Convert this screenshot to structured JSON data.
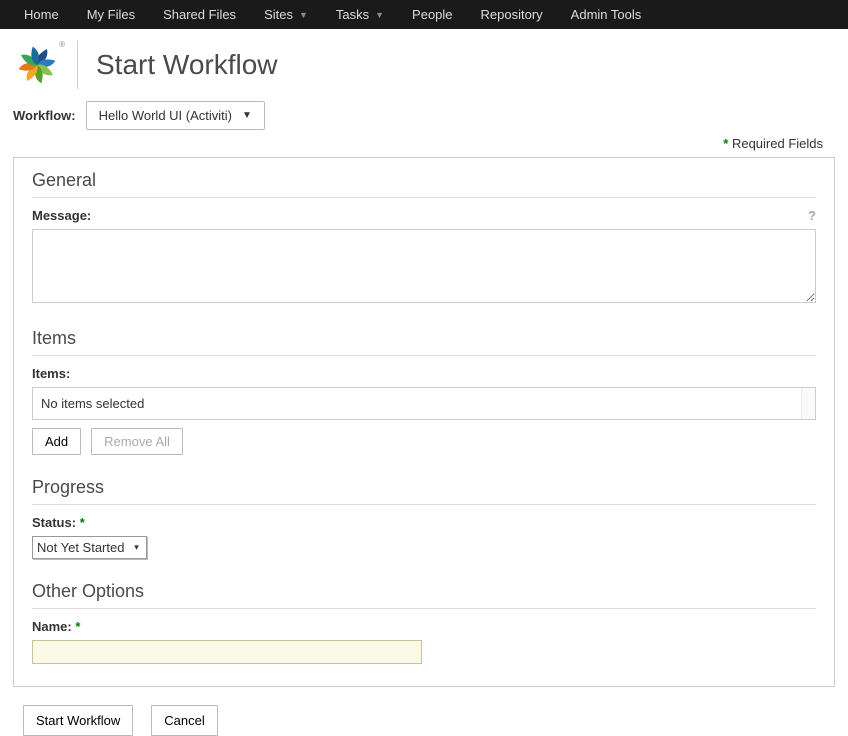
{
  "topnav": {
    "items": [
      {
        "label": "Home",
        "dropdown": false
      },
      {
        "label": "My Files",
        "dropdown": false
      },
      {
        "label": "Shared Files",
        "dropdown": false
      },
      {
        "label": "Sites",
        "dropdown": true
      },
      {
        "label": "Tasks",
        "dropdown": true
      },
      {
        "label": "People",
        "dropdown": false
      },
      {
        "label": "Repository",
        "dropdown": false
      },
      {
        "label": "Admin Tools",
        "dropdown": false
      }
    ]
  },
  "header": {
    "title": "Start Workflow"
  },
  "workflow": {
    "label": "Workflow:",
    "selected": "Hello World UI (Activiti)"
  },
  "required_note": "Required Fields",
  "sections": {
    "general": {
      "title": "General",
      "message_label": "Message:",
      "message_value": ""
    },
    "items": {
      "title": "Items",
      "label": "Items:",
      "empty_text": "No items selected",
      "add_label": "Add",
      "remove_all_label": "Remove All"
    },
    "progress": {
      "title": "Progress",
      "status_label": "Status:",
      "status_value": "Not Yet Started"
    },
    "other": {
      "title": "Other Options",
      "name_label": "Name:",
      "name_value": ""
    }
  },
  "actions": {
    "submit": "Start Workflow",
    "cancel": "Cancel"
  },
  "colors": {
    "required_star": "#008000"
  }
}
